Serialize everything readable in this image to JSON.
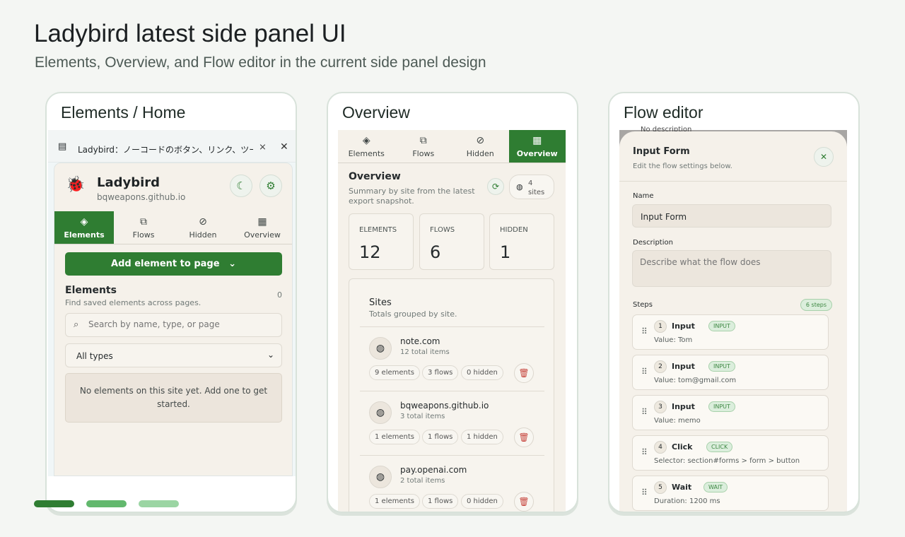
{
  "heading": {
    "title": "Ladybird latest side panel UI",
    "subtitle": "Elements, Overview, and Flow editor in the current side panel design"
  },
  "cards": {
    "elements_home": {
      "title": "Elements / Home",
      "window": {
        "title": "Ladybird：ノーコードのボタン、リンク、ツール..."
      },
      "app": {
        "name": "Ladybird",
        "site": "bqweapons.github.io"
      },
      "nav": {
        "elements": "Elements",
        "flows": "Flows",
        "hidden": "Hidden",
        "overview": "Overview"
      },
      "add_button": "Add element to page",
      "section": {
        "title": "Elements",
        "subtitle": "Find saved elements across pages.",
        "count": "0"
      },
      "search_placeholder": "Search by name, type, or page",
      "type_filter": "All types",
      "empty_message": "No elements on this site yet. Add one to get started."
    },
    "overview": {
      "title": "Overview",
      "nav": {
        "elements": "Elements",
        "flows": "Flows",
        "hidden": "Hidden",
        "overview": "Overview"
      },
      "section_title": "Overview",
      "section_subtitle": "Summary by site from the latest export snapshot.",
      "sites_badge": "4 sites",
      "stats": {
        "elements_label": "ELEMENTS",
        "elements_value": "12",
        "flows_label": "FLOWS",
        "flows_value": "6",
        "hidden_label": "HIDDEN",
        "hidden_value": "1"
      },
      "sites_panel": {
        "title": "Sites",
        "subtitle": "Totals grouped by site.",
        "items": [
          {
            "domain": "note.com",
            "total": "12 total items",
            "elements": "9 elements",
            "flows": "3 flows",
            "hidden": "0 hidden"
          },
          {
            "domain": "bqweapons.github.io",
            "total": "3 total items",
            "elements": "1 elements",
            "flows": "1 flows",
            "hidden": "1 hidden"
          },
          {
            "domain": "pay.openai.com",
            "total": "2 total items",
            "elements": "1 elements",
            "flows": "1 flows",
            "hidden": "0 hidden"
          }
        ]
      }
    },
    "flow_editor": {
      "title": "Flow editor",
      "behind_text": "No description",
      "dialog_title": "Input Form",
      "dialog_subtitle": "Edit the flow settings below.",
      "name_label": "Name",
      "name_value": "Input Form",
      "description_label": "Description",
      "description_placeholder": "Describe what the flow does",
      "steps_label": "Steps",
      "steps_count": "6 steps",
      "steps": [
        {
          "num": "1",
          "name": "Input",
          "badge": "INPUT",
          "detail": "Value: Tom"
        },
        {
          "num": "2",
          "name": "Input",
          "badge": "INPUT",
          "detail": "Value: tom@gmail.com"
        },
        {
          "num": "3",
          "name": "Input",
          "badge": "INPUT",
          "detail": "Value: memo"
        },
        {
          "num": "4",
          "name": "Click",
          "badge": "CLICK",
          "detail": "Selector: section#forms > form > button"
        },
        {
          "num": "5",
          "name": "Wait",
          "badge": "WAIT",
          "detail": "Duration: 1200 ms"
        }
      ]
    }
  },
  "colors": {
    "accent_green": "#2f7d32",
    "indicator_1": "#2f7d32",
    "indicator_2": "#62b86d",
    "indicator_3": "#9bd5a3",
    "danger": "#c6433b"
  },
  "icons": {
    "ladybird_logo": "ladybird-logo-icon",
    "theme": "moon-icon",
    "settings": "gear-icon",
    "refresh": "refresh-icon",
    "globe": "globe-icon",
    "delete": "trash-icon",
    "close": "close-icon",
    "pin": "pin-off-icon",
    "drag": "drag-handle-icon"
  }
}
